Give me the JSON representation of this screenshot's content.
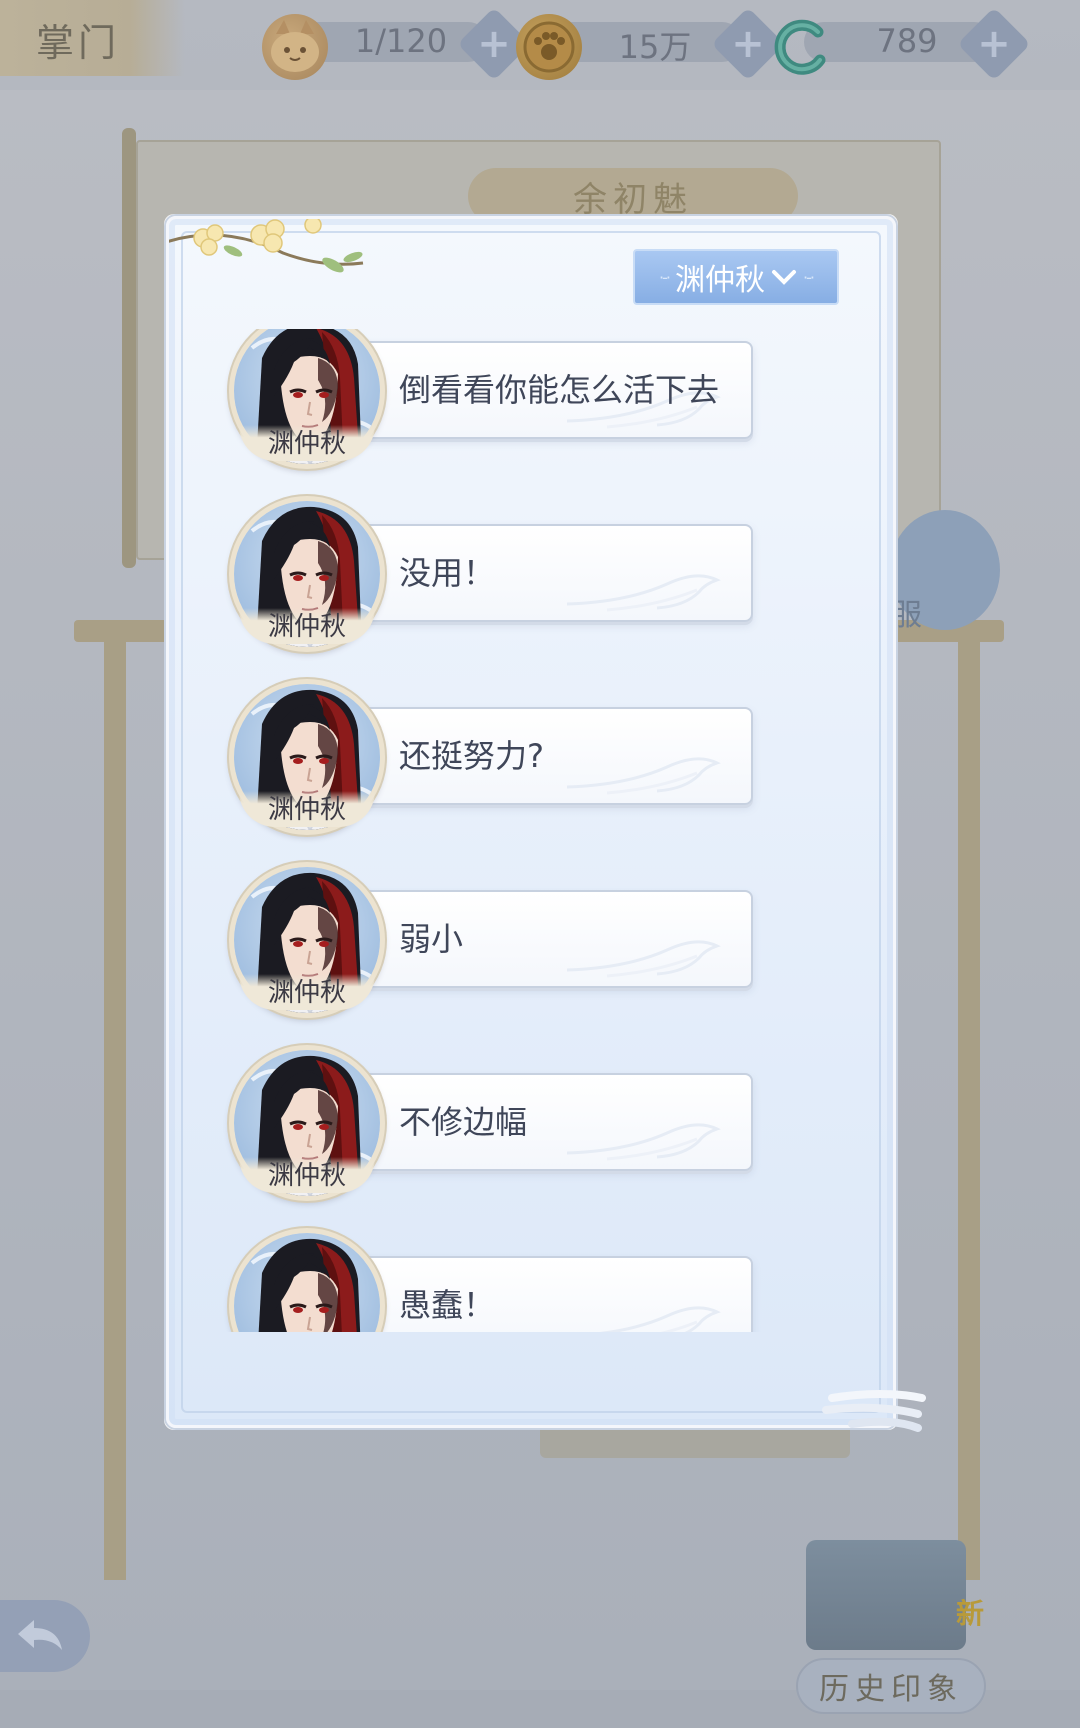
{
  "topbar": {
    "page_title": "掌门",
    "resources": [
      {
        "icon": "cat-coin-icon",
        "value": "1/120"
      },
      {
        "icon": "paw-coin-icon",
        "value": "15万"
      },
      {
        "icon": "jade-coin-icon",
        "value": "789"
      }
    ],
    "add_label": "+"
  },
  "background": {
    "name_tag": "余初魅",
    "badge_text": "服"
  },
  "modal": {
    "filter_label": "渊仲秋",
    "items": [
      {
        "speaker": "渊仲秋",
        "text": "倒看看你能怎么活下去"
      },
      {
        "speaker": "渊仲秋",
        "text": "没用！"
      },
      {
        "speaker": "渊仲秋",
        "text": "还挺努力?"
      },
      {
        "speaker": "渊仲秋",
        "text": "弱小"
      },
      {
        "speaker": "渊仲秋",
        "text": "不修边幅"
      },
      {
        "speaker": "渊仲秋",
        "text": "愚蠢！"
      }
    ]
  },
  "bottom": {
    "history_label": "历史印象",
    "new_badge": "新"
  },
  "colors": {
    "accent_blue": "#87aee4",
    "text_dark": "#3f4659",
    "hair_red": "#8c1b1b"
  }
}
